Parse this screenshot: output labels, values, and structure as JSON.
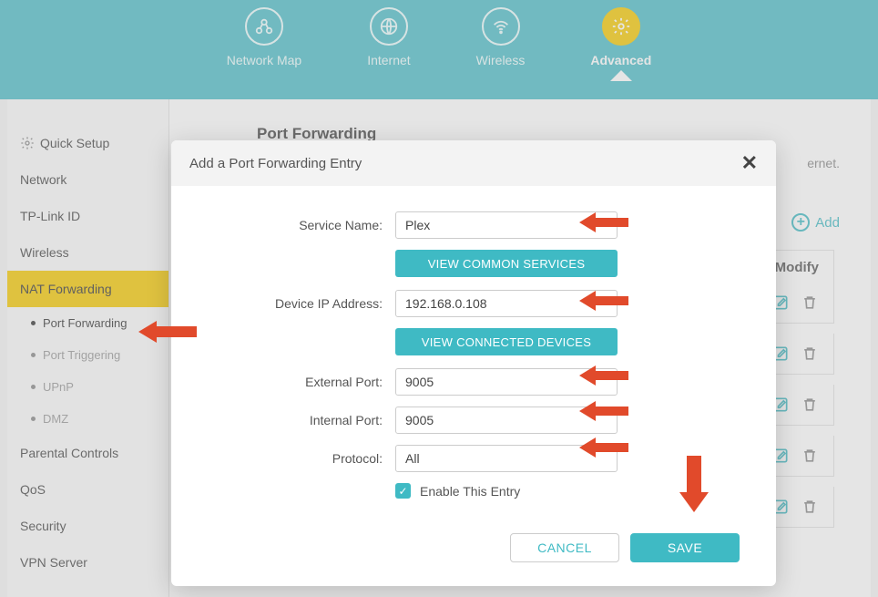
{
  "nav": {
    "items": [
      {
        "label": "Network Map"
      },
      {
        "label": "Internet"
      },
      {
        "label": "Wireless"
      },
      {
        "label": "Advanced"
      }
    ]
  },
  "sidebar": {
    "quick_setup": "Quick Setup",
    "network": "Network",
    "tplink_id": "TP-Link ID",
    "wireless": "Wireless",
    "nat_forwarding": "NAT Forwarding",
    "subs": {
      "port_forwarding": "Port Forwarding",
      "port_triggering": "Port Triggering",
      "upnp": "UPnP",
      "dmz": "DMZ"
    },
    "parental": "Parental Controls",
    "qos": "QoS",
    "security": "Security",
    "vpn": "VPN Server"
  },
  "page": {
    "title": "Port Forwarding",
    "desc_fragment": "ernet.",
    "add_label": "Add",
    "modify_header": "Modify"
  },
  "modal": {
    "title": "Add a Port Forwarding Entry",
    "labels": {
      "service_name": "Service Name:",
      "device_ip": "Device IP Address:",
      "external_port": "External Port:",
      "internal_port": "Internal Port:",
      "protocol": "Protocol:"
    },
    "values": {
      "service_name": "Plex",
      "device_ip": "192.168.0.108",
      "external_port": "9005",
      "internal_port": "9005",
      "protocol": "All"
    },
    "buttons": {
      "view_common": "VIEW COMMON SERVICES",
      "view_devices": "VIEW CONNECTED DEVICES",
      "cancel": "CANCEL",
      "save": "SAVE"
    },
    "enable_label": "Enable This Entry",
    "enable_checked": true
  }
}
